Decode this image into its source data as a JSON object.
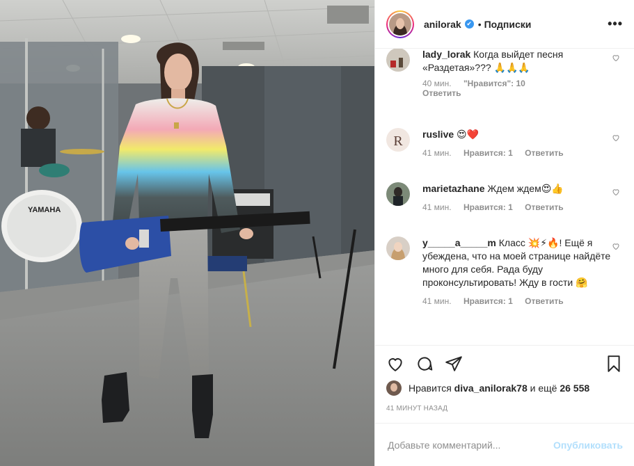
{
  "header": {
    "username": "anilorak",
    "verified_mark": "✔",
    "separator": "•",
    "follow_label": "Подписки",
    "more_label": "•••"
  },
  "comments": [
    {
      "user": "lady_lorak",
      "text": "Когда выйдет песня «Раздетая»??? 🙏🙏🙏",
      "time": "40 мин.",
      "likes": "\"Нравится\": 10",
      "reply": "Ответить"
    },
    {
      "user": "ruslive",
      "text": "😍❤️",
      "time": "41 мин.",
      "likes": "Нравится: 1",
      "reply": "Ответить"
    },
    {
      "user": "marietazhane",
      "text": "Ждем ждем😍👍",
      "time": "41 мин.",
      "likes": "Нравится: 1",
      "reply": "Ответить"
    },
    {
      "user": "y_____a_____m",
      "text": "Класс 💥⚡🔥! Ещё я убеждена, что на моей странице найдёте много для себя. Рада буду проконсультировать! Жду в гости 🤗",
      "time": "41 мин.",
      "likes": "Нравится: 1",
      "reply": "Ответить"
    }
  ],
  "actions": {
    "like_icon": "heart-icon",
    "comment_icon": "comment-icon",
    "share_icon": "paper-plane-icon",
    "save_icon": "bookmark-icon"
  },
  "likes": {
    "prefix": "Нравится",
    "user": "diva_anilorak78",
    "middle": "и ещё",
    "count": "26 558"
  },
  "time_ago": "41 МИНУТ НАЗАД",
  "add_comment": {
    "placeholder": "Добавьте комментарий...",
    "publish_label": "Опубликовать"
  },
  "colors": {
    "accent": "#3897f0",
    "publish_disabled": "#b2dffc",
    "text": "#262626",
    "meta": "#8e8e8e"
  }
}
